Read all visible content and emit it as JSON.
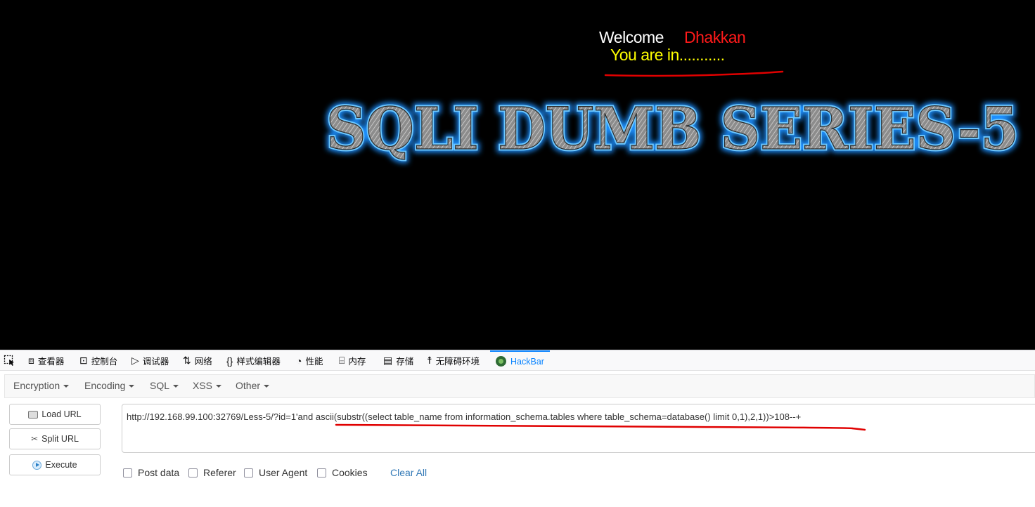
{
  "page": {
    "welcome": "Welcome",
    "user_name": "Dhakkan",
    "status": "You are in...........",
    "title": "SQLI DUMB SERIES-5",
    "colors": {
      "background": "#000000",
      "welcome": "#ffffff",
      "user": "#ff1a1a",
      "status": "#ffff00",
      "title_glow": "#1e90ff",
      "annotation": "#e00000"
    }
  },
  "devtools": {
    "tabs": [
      {
        "icon": "inspector-icon",
        "label": "查看器"
      },
      {
        "icon": "console-icon",
        "label": "控制台"
      },
      {
        "icon": "debugger-icon",
        "label": "调试器"
      },
      {
        "icon": "network-icon",
        "label": "网络"
      },
      {
        "icon": "style-editor-icon",
        "label": "样式编辑器"
      },
      {
        "icon": "performance-icon",
        "label": "性能"
      },
      {
        "icon": "memory-icon",
        "label": "内存"
      },
      {
        "icon": "storage-icon",
        "label": "存储"
      },
      {
        "icon": "accessibility-icon",
        "label": "无障碍环境"
      },
      {
        "icon": "hackbar-icon",
        "label": "HackBar"
      }
    ],
    "active_tab": "HackBar"
  },
  "hackbar": {
    "menus": [
      "Encryption",
      "Encoding",
      "SQL",
      "XSS",
      "Other"
    ],
    "buttons": {
      "load_url": "Load URL",
      "split_url": "Split URL",
      "execute": "Execute"
    },
    "url_value": "http://192.168.99.100:32769/Less-5/?id=1'and ascii(substr((select table_name from information_schema.tables where table_schema=database() limit 0,1),2,1))>108--+",
    "checkboxes": [
      "Post data",
      "Referer",
      "User Agent",
      "Cookies"
    ],
    "clear_all": "Clear All"
  }
}
